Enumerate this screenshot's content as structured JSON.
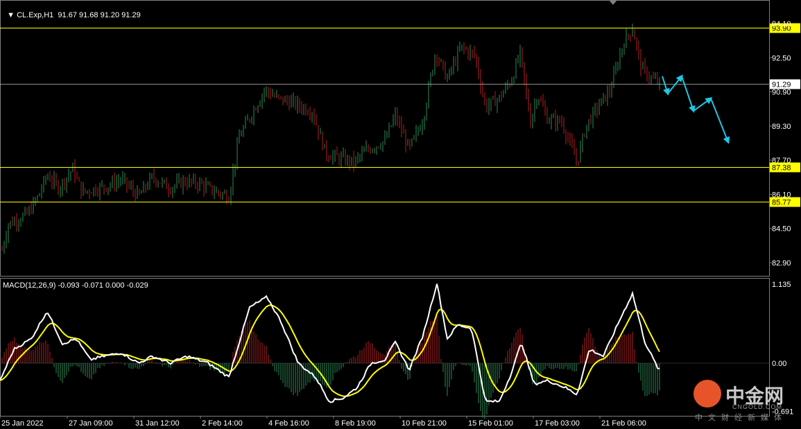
{
  "main_chart": {
    "symbol_label": "CL.Exp,H1",
    "ohlc": "91.67 91.68 91.20 91.29",
    "price_ticks": [
      "94.10",
      "92.50",
      "90.90",
      "89.30",
      "87.70",
      "86.10",
      "84.50",
      "82.90"
    ],
    "level_lines": [
      {
        "value": "93.90",
        "color": "#ffff00"
      },
      {
        "value": "87.38",
        "color": "#ffff00"
      },
      {
        "value": "85.77",
        "color": "#ffff00"
      }
    ],
    "current_price": "91.29"
  },
  "macd": {
    "label": "MACD(12,26,9) -0.093 -0.071 0.000 -0.029",
    "ticks": [
      "1.135",
      "0.00",
      "-0.691"
    ]
  },
  "time_axis": [
    "25 Jan 2022",
    "27 Jan 09:00",
    "31 Jan 12:00",
    "2 Feb 14:00",
    "4 Feb 16:00",
    "8 Feb 19:00",
    "10 Feb 21:00",
    "15 Feb 01:00",
    "17 Feb 03:00",
    "21 Feb 06:00"
  ],
  "colors": {
    "bull": "#2e8b57",
    "bear": "#b22222",
    "level": "#ffff00",
    "current": "#c0c0c0",
    "arrow": "#1fc8e6",
    "macd_line": "#ffffff",
    "signal_line": "#ffff00",
    "hist_pos": "#b22222",
    "hist_neg": "#2e8b57"
  },
  "watermark": {
    "brand": "中金网",
    "domain": "CNGOLD.COM",
    "tagline": "中文财经新媒体"
  }
}
